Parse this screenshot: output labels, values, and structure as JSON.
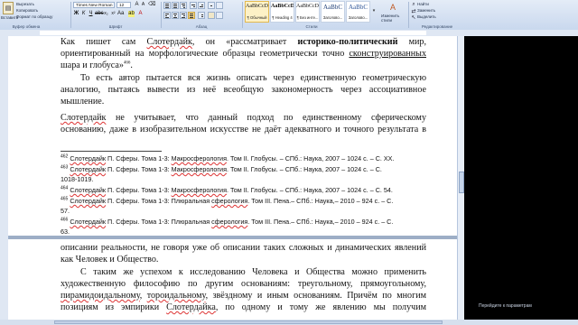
{
  "ribbon": {
    "clipboard": {
      "cut": "Вырезать",
      "copy": "Копировать",
      "format_painter": "Формат по образцу",
      "paste": "Вставить",
      "group_label": "Буфер обмена"
    },
    "font": {
      "family": "Times New Roman",
      "size": "12",
      "group_label": "Шрифт"
    },
    "paragraph": {
      "group_label": "Абзац"
    },
    "styles": {
      "items": [
        {
          "sample": "AaBbCcDd",
          "name": "¶ Обычный"
        },
        {
          "sample": "AaBbCcDd",
          "name": "¶ Heading 4"
        },
        {
          "sample": "AaBbCcDd",
          "name": "¶ Без инте..."
        },
        {
          "sample": "AaBbC",
          "name": "Заголово..."
        },
        {
          "sample": "AaBbC",
          "name": "Заголово..."
        }
      ],
      "change_styles": "Изменить стили",
      "group_label": "Стили"
    },
    "editing": {
      "find": "Найти",
      "replace": "Заменить",
      "select": "Выделить",
      "group_label": "Редактирование"
    }
  },
  "page1": {
    "body_lines": [
      {
        "parts": [
          {
            "t": "Как пишет сам "
          },
          {
            "t": "Слотердайк",
            "s": "sq"
          },
          {
            "t": ", он «рассматривает "
          },
          {
            "t": "историко-политический",
            "b": true
          },
          {
            "t": " мир,"
          }
        ]
      },
      {
        "parts": [
          {
            "t": "ориентированный на морфологические образцы геометрически точно "
          },
          {
            "t": "сконструированных",
            "s": "ul"
          }
        ]
      },
      {
        "parts": [
          {
            "t": "шара и глобуса»"
          },
          {
            "t": "466",
            "sup": true
          },
          {
            "t": "."
          }
        ]
      },
      {
        "parts": [
          {
            "t": "То есть автор пытается вся жизнь описать через  единственную геометрическую"
          }
        ]
      },
      {
        "parts": [
          {
            "t": "аналогию, пытаясь вывести из неё всеобщую закономерность через ассоциативное"
          }
        ]
      },
      {
        "parts": [
          {
            "t": "мышление."
          }
        ]
      },
      {
        "parts": [
          {
            "t": "Слотердайк",
            "s": "sq"
          },
          {
            "t": " не учитывает, что данный подход по единственному сферическому"
          }
        ]
      },
      {
        "parts": [
          {
            "t": "основанию, даже в изобразительном искусстве не даёт адекватного и точного результата в"
          }
        ]
      }
    ],
    "footnotes": [
      {
        "parts": [
          {
            "t": "462",
            "sup": true
          },
          {
            "t": " "
          },
          {
            "t": "Слотердайк",
            "s": "sq"
          },
          {
            "t": " П. Сферы. Тома 1-3: "
          },
          {
            "t": "Макросферология",
            "s": "sq"
          },
          {
            "t": ". Том II. Глобусы. – СПб.: Наука, 2007 – 1024 с. – С. XX."
          }
        ]
      },
      {
        "parts": [
          {
            "t": "463",
            "sup": true
          },
          {
            "t": " "
          },
          {
            "t": "Слотердайк",
            "s": "sq"
          },
          {
            "t": " П. Сферы. Тома 1-3: "
          },
          {
            "t": "Макросферология",
            "s": "sq"
          },
          {
            "t": ". Том II. Глобусы. – СПб.: Наука, 2007 – 1024 с.  – С."
          }
        ]
      },
      {
        "parts": [
          {
            "t": "1018-1019."
          }
        ]
      },
      {
        "parts": [
          {
            "t": "464",
            "sup": true
          },
          {
            "t": " "
          },
          {
            "t": "Слотердайк",
            "s": "sq"
          },
          {
            "t": " П. Сферы. Тома 1-3: "
          },
          {
            "t": "Макросферология",
            "s": "sq"
          },
          {
            "t": ". Том II. Глобусы. – СПб.: Наука, 2007 – 1024 с. – С. 54."
          }
        ]
      },
      {
        "parts": [
          {
            "t": "465",
            "sup": true
          },
          {
            "t": " "
          },
          {
            "t": "Слотердайк",
            "s": "sq"
          },
          {
            "t": " П. Сферы. Тома 1-3: Плюральная "
          },
          {
            "t": "сферология",
            "s": "sq"
          },
          {
            "t": ". Том III. Пена.– СПб.: Наука,– 2010 – 924 с. – С."
          }
        ]
      },
      {
        "parts": [
          {
            "t": "57."
          }
        ]
      },
      {
        "parts": [
          {
            "t": "466",
            "sup": true
          },
          {
            "t": " "
          },
          {
            "t": "Слотердайк",
            "s": "sq"
          },
          {
            "t": " П. Сферы. Тома 1-3: Плюральная "
          },
          {
            "t": "сферология",
            "s": "sq"
          },
          {
            "t": ". Том III. Пена.– СПб.: Наука,– 2010 – 924 с. – С."
          }
        ]
      },
      {
        "parts": [
          {
            "t": "63."
          }
        ]
      }
    ]
  },
  "page2": {
    "body_lines": [
      {
        "parts": [
          {
            "t": "описании реальности, не говоря уже об описании таких сложных и динамических явлений"
          }
        ]
      },
      {
        "parts": [
          {
            "t": "как Человек и Общество."
          }
        ]
      },
      {
        "parts": [
          {
            "t": "С таким же успехом к исследованию Человека и Общества можно применить"
          }
        ]
      },
      {
        "parts": [
          {
            "t": "художественную философию по другим основаниям: треугольному, прямоугольному,"
          }
        ]
      },
      {
        "parts": [
          {
            "t": "пирамидоидальному",
            "s": "sq"
          },
          {
            "t": ", "
          },
          {
            "t": "тороидальному",
            "s": "sq"
          },
          {
            "t": ", звёздному и иным основаниям. Причём по многим"
          }
        ]
      },
      {
        "parts": [
          {
            "t": "позициям из эмпирики "
          },
          {
            "t": "Слотердайка",
            "s": "sq"
          },
          {
            "t": ", по одному и тому же явлению мы получим"
          }
        ]
      }
    ]
  },
  "watermark": "Перейдите к параметрам"
}
